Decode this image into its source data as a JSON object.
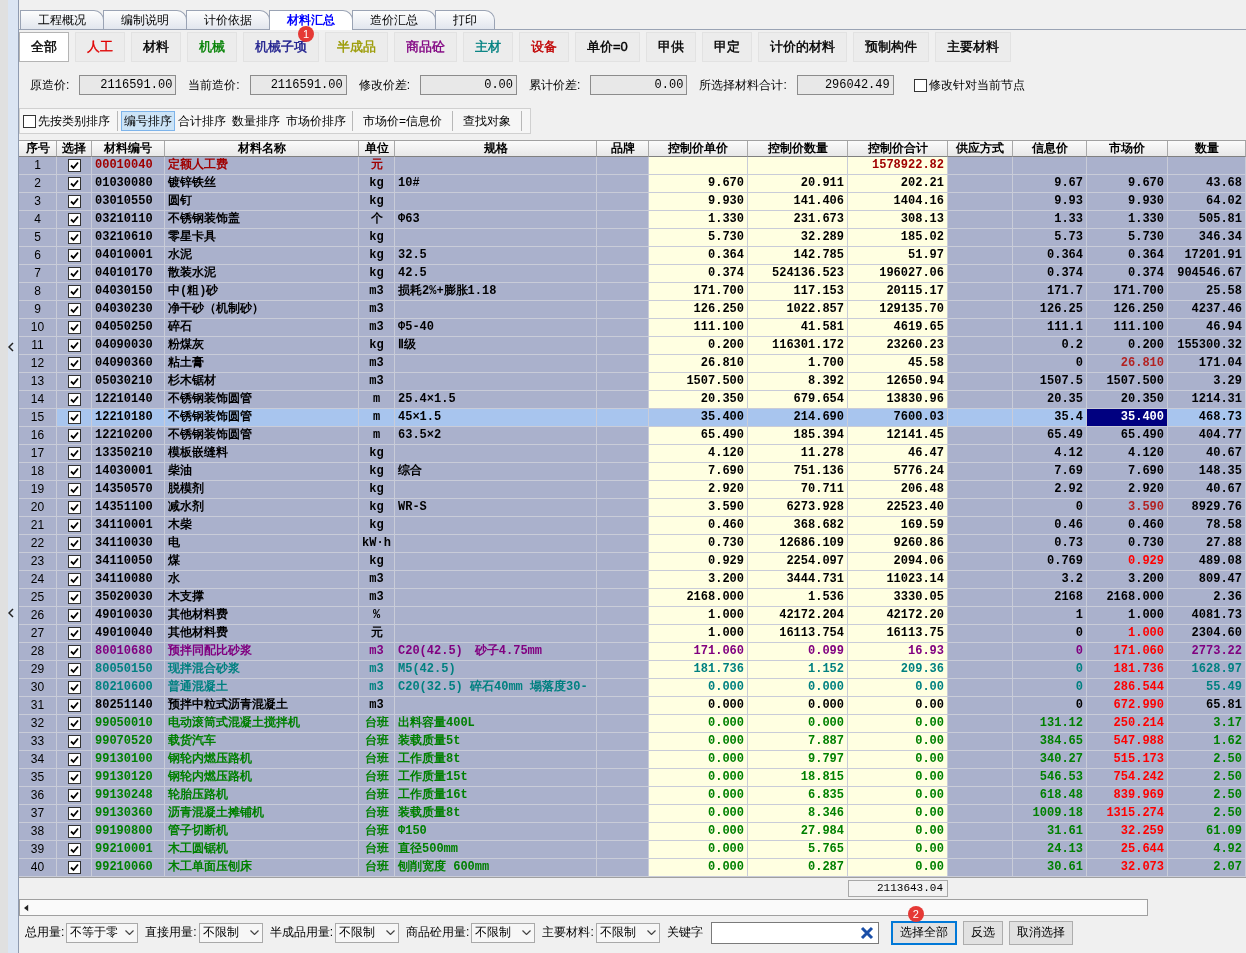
{
  "tabs": [
    {
      "label": "工程概况",
      "selected": false
    },
    {
      "label": "编制说明",
      "selected": false
    },
    {
      "label": "计价依据",
      "selected": false
    },
    {
      "label": "材料汇总",
      "selected": true
    },
    {
      "label": "造价汇总",
      "selected": false
    },
    {
      "label": "打印",
      "selected": false
    }
  ],
  "filters": [
    {
      "label": "全部",
      "color": "#000000",
      "selected": true
    },
    {
      "label": "人工",
      "color": "#e00000",
      "selected": false
    },
    {
      "label": "材料",
      "color": "#000000",
      "selected": false
    },
    {
      "label": "机械",
      "color": "#008000",
      "selected": false
    },
    {
      "label": "机械子项",
      "color": "#1c1c8c",
      "selected": false,
      "badge": "1"
    },
    {
      "label": "半成品",
      "color": "#9a9a00",
      "selected": false
    },
    {
      "label": "商品砼",
      "color": "#800080",
      "selected": false
    },
    {
      "label": "主材",
      "color": "#008080",
      "selected": false
    },
    {
      "label": "设备",
      "color": "#c00000",
      "selected": false
    },
    {
      "label": "单价=0",
      "color": "#000000",
      "selected": false
    },
    {
      "label": "甲供",
      "color": "#000000",
      "selected": false
    },
    {
      "label": "甲定",
      "color": "#000000",
      "selected": false
    },
    {
      "label": "计价的材料",
      "color": "#000000",
      "selected": false
    },
    {
      "label": "预制构件",
      "color": "#000000",
      "selected": false
    },
    {
      "label": "主要材料",
      "color": "#000000",
      "selected": false
    }
  ],
  "totals": [
    {
      "label": "原造价:",
      "value": "2116591.00"
    },
    {
      "label": "当前造价:",
      "value": "2116591.00"
    },
    {
      "label": "修改价差:",
      "value": "0.00"
    },
    {
      "label": "累计价差:",
      "value": "0.00"
    },
    {
      "label": "所选择材料合计:",
      "value": "296042.49"
    }
  ],
  "node_option": {
    "label": "修改针对当前节点",
    "checked": false
  },
  "sort_bar": {
    "category_first": {
      "label": "先按类别排序",
      "checked": false
    },
    "sorts": [
      {
        "label": "编号排序",
        "selected": true
      },
      {
        "label": "合计排序",
        "selected": false
      },
      {
        "label": "数量排序",
        "selected": false
      },
      {
        "label": "市场价排序",
        "selected": false
      }
    ],
    "actions": [
      "市场价=信息价",
      "查找对象"
    ]
  },
  "table": {
    "columns": [
      "序号",
      "选择",
      "材料编号",
      "材料名称",
      "单位",
      "规格",
      "品牌",
      "控制价单价",
      "控制价数量",
      "控制价合计",
      "供应方式",
      "信息价",
      "市场价",
      "数量"
    ],
    "rows": [
      {
        "no": "1",
        "checked": true,
        "selected": false,
        "color": "#a00000",
        "code": "00010040",
        "name": "定额人工费",
        "unit": "元",
        "ctrl_total": "1578922.82"
      },
      {
        "no": "2",
        "checked": true,
        "selected": false,
        "color": "#000000",
        "code": "01030080",
        "name": "镀锌铁丝",
        "unit": "kg",
        "spec": "10#",
        "ctrl_price": "9.670",
        "ctrl_qty": "20.911",
        "ctrl_total": "202.21",
        "info_price": "9.67",
        "market_price": {
          "text": "9.670",
          "color": "#000000"
        },
        "qty": "43.68"
      },
      {
        "no": "3",
        "checked": true,
        "selected": false,
        "color": "#000000",
        "code": "03010550",
        "name": "圆钉",
        "unit": "kg",
        "ctrl_price": "9.930",
        "ctrl_qty": "141.406",
        "ctrl_total": "1404.16",
        "info_price": "9.93",
        "market_price": {
          "text": "9.930",
          "color": "#000000"
        },
        "qty": "64.02"
      },
      {
        "no": "4",
        "checked": true,
        "selected": false,
        "color": "#000000",
        "code": "03210110",
        "name": "不锈钢装饰盖",
        "unit": "个",
        "spec": "Φ63",
        "ctrl_price": "1.330",
        "ctrl_qty": "231.673",
        "ctrl_total": "308.13",
        "info_price": "1.33",
        "market_price": {
          "text": "1.330",
          "color": "#000000"
        },
        "qty": "505.81"
      },
      {
        "no": "5",
        "checked": true,
        "selected": false,
        "color": "#000000",
        "code": "03210610",
        "name": "零星卡具",
        "unit": "kg",
        "ctrl_price": "5.730",
        "ctrl_qty": "32.289",
        "ctrl_total": "185.02",
        "info_price": "5.73",
        "market_price": {
          "text": "5.730",
          "color": "#000000"
        },
        "qty": "346.34"
      },
      {
        "no": "6",
        "checked": true,
        "selected": false,
        "color": "#000000",
        "code": "04010001",
        "name": "水泥",
        "unit": "kg",
        "spec": "32.5",
        "ctrl_price": "0.364",
        "ctrl_qty": "142.785",
        "ctrl_total": "51.97",
        "info_price": "0.364",
        "market_price": {
          "text": "0.364",
          "color": "#000000"
        },
        "qty": "17201.91"
      },
      {
        "no": "7",
        "checked": true,
        "selected": false,
        "color": "#000000",
        "code": "04010170",
        "name": "散装水泥",
        "unit": "kg",
        "spec": "42.5",
        "ctrl_price": "0.374",
        "ctrl_qty": "524136.523",
        "ctrl_total": "196027.06",
        "info_price": "0.374",
        "market_price": {
          "text": "0.374",
          "color": "#000000"
        },
        "qty": "904546.67"
      },
      {
        "no": "8",
        "checked": true,
        "selected": false,
        "color": "#000000",
        "code": "04030150",
        "name": "中(粗)砂",
        "unit": "m3",
        "spec": "损耗2%+膨胀1.18",
        "ctrl_price": "171.700",
        "ctrl_qty": "117.153",
        "ctrl_total": "20115.17",
        "info_price": "171.7",
        "market_price": {
          "text": "171.700",
          "color": "#000000"
        },
        "qty": "25.58"
      },
      {
        "no": "9",
        "checked": true,
        "selected": false,
        "color": "#000000",
        "code": "04030230",
        "name": "净干砂（机制砂）",
        "unit": "m3",
        "ctrl_price": "126.250",
        "ctrl_qty": "1022.857",
        "ctrl_total": "129135.70",
        "info_price": "126.25",
        "market_price": {
          "text": "126.250",
          "color": "#000000"
        },
        "qty": "4237.46"
      },
      {
        "no": "10",
        "checked": true,
        "selected": false,
        "color": "#000000",
        "code": "04050250",
        "name": "碎石",
        "unit": "m3",
        "spec": "Φ5-40",
        "ctrl_price": "111.100",
        "ctrl_qty": "41.581",
        "ctrl_total": "4619.65",
        "info_price": "111.1",
        "market_price": {
          "text": "111.100",
          "color": "#000000"
        },
        "qty": "46.94"
      },
      {
        "no": "11",
        "checked": true,
        "selected": false,
        "color": "#000000",
        "code": "04090030",
        "name": "粉煤灰",
        "unit": "kg",
        "spec": "Ⅱ级",
        "ctrl_price": "0.200",
        "ctrl_qty": "116301.172",
        "ctrl_total": "23260.23",
        "info_price": "0.2",
        "market_price": {
          "text": "0.200",
          "color": "#000000"
        },
        "qty": "155300.32"
      },
      {
        "no": "12",
        "checked": true,
        "selected": false,
        "color": "#000000",
        "code": "04090360",
        "name": "粘土膏",
        "unit": "m3",
        "ctrl_price": "26.810",
        "ctrl_qty": "1.700",
        "ctrl_total": "45.58",
        "info_price": "0",
        "market_price": {
          "text": "26.810",
          "color": "#b22222"
        },
        "qty": "171.04"
      },
      {
        "no": "13",
        "checked": true,
        "selected": false,
        "color": "#000000",
        "code": "05030210",
        "name": "杉木锯材",
        "unit": "m3",
        "ctrl_price": "1507.500",
        "ctrl_qty": "8.392",
        "ctrl_total": "12650.94",
        "info_price": "1507.5",
        "market_price": {
          "text": "1507.500",
          "color": "#000000"
        },
        "qty": "3.29"
      },
      {
        "no": "14",
        "checked": true,
        "selected": false,
        "color": "#000000",
        "code": "12210140",
        "name": "不锈钢装饰圆管",
        "unit": "m",
        "spec": "25.4×1.5",
        "ctrl_price": "20.350",
        "ctrl_qty": "679.654",
        "ctrl_total": "13830.96",
        "info_price": "20.35",
        "market_price": {
          "text": "20.350",
          "color": "#000000"
        },
        "qty": "1214.31"
      },
      {
        "no": "15",
        "checked": true,
        "selected": true,
        "code": "12210180",
        "name": "不锈钢装饰圆管",
        "unit": "m",
        "spec": "45×1.5",
        "ctrl_price": "35.400",
        "ctrl_qty": "214.690",
        "ctrl_total": "7600.03",
        "info_price": "35.4",
        "market_price": {
          "text": "35.400"
        },
        "qty": "468.73"
      },
      {
        "no": "16",
        "checked": true,
        "selected": false,
        "color": "#000000",
        "code": "12210200",
        "name": "不锈钢装饰圆管",
        "unit": "m",
        "spec": "63.5×2",
        "ctrl_price": "65.490",
        "ctrl_qty": "185.394",
        "ctrl_total": "12141.45",
        "info_price": "65.49",
        "market_price": {
          "text": "65.490",
          "color": "#000000"
        },
        "qty": "404.77"
      },
      {
        "no": "17",
        "checked": true,
        "selected": false,
        "color": "#000000",
        "code": "13350210",
        "name": "模板嵌缝料",
        "unit": "kg",
        "ctrl_price": "4.120",
        "ctrl_qty": "11.278",
        "ctrl_total": "46.47",
        "info_price": "4.12",
        "market_price": {
          "text": "4.120",
          "color": "#000000"
        },
        "qty": "40.67"
      },
      {
        "no": "18",
        "checked": true,
        "selected": false,
        "color": "#000000",
        "code": "14030001",
        "name": "柴油",
        "unit": "kg",
        "spec": "综合",
        "ctrl_price": "7.690",
        "ctrl_qty": "751.136",
        "ctrl_total": "5776.24",
        "info_price": "7.69",
        "market_price": {
          "text": "7.690",
          "color": "#000000"
        },
        "qty": "148.35"
      },
      {
        "no": "19",
        "checked": true,
        "selected": false,
        "color": "#000000",
        "code": "14350570",
        "name": "脱模剂",
        "unit": "kg",
        "ctrl_price": "2.920",
        "ctrl_qty": "70.711",
        "ctrl_total": "206.48",
        "info_price": "2.92",
        "market_price": {
          "text": "2.920",
          "color": "#000000"
        },
        "qty": "40.67"
      },
      {
        "no": "20",
        "checked": true,
        "selected": false,
        "color": "#000000",
        "code": "14351100",
        "name": "减水剂",
        "unit": "kg",
        "spec": "WR-S",
        "ctrl_price": "3.590",
        "ctrl_qty": "6273.928",
        "ctrl_total": "22523.40",
        "info_price": "0",
        "market_price": {
          "text": "3.590",
          "color": "#b22222"
        },
        "qty": "8929.76"
      },
      {
        "no": "21",
        "checked": true,
        "selected": false,
        "color": "#000000",
        "code": "34110001",
        "name": "木柴",
        "unit": "kg",
        "ctrl_price": "0.460",
        "ctrl_qty": "368.682",
        "ctrl_total": "169.59",
        "info_price": "0.46",
        "market_price": {
          "text": "0.460",
          "color": "#000000"
        },
        "qty": "78.58"
      },
      {
        "no": "22",
        "checked": true,
        "selected": false,
        "color": "#000000",
        "code": "34110030",
        "name": "电",
        "unit": "kW·h",
        "ctrl_price": "0.730",
        "ctrl_qty": "12686.109",
        "ctrl_total": "9260.86",
        "info_price": "0.73",
        "market_price": {
          "text": "0.730",
          "color": "#000000"
        },
        "qty": "27.88"
      },
      {
        "no": "23",
        "checked": true,
        "selected": false,
        "color": "#000000",
        "code": "34110050",
        "name": "煤",
        "unit": "kg",
        "ctrl_price": "0.929",
        "ctrl_qty": "2254.097",
        "ctrl_total": "2094.06",
        "info_price": "0.769",
        "market_price": {
          "text": "0.929",
          "color": "#ff0000"
        },
        "qty": "489.08"
      },
      {
        "no": "24",
        "checked": true,
        "selected": false,
        "color": "#000000",
        "code": "34110080",
        "name": "水",
        "unit": "m3",
        "ctrl_price": "3.200",
        "ctrl_qty": "3444.731",
        "ctrl_total": "11023.14",
        "info_price": "3.2",
        "market_price": {
          "text": "3.200",
          "color": "#000000"
        },
        "qty": "809.47"
      },
      {
        "no": "25",
        "checked": true,
        "selected": false,
        "color": "#000000",
        "code": "35020030",
        "name": "木支撑",
        "unit": "m3",
        "ctrl_price": "2168.000",
        "ctrl_qty": "1.536",
        "ctrl_total": "3330.05",
        "info_price": "2168",
        "market_price": {
          "text": "2168.000",
          "color": "#000000"
        },
        "qty": "2.36"
      },
      {
        "no": "26",
        "checked": true,
        "selected": false,
        "color": "#000000",
        "code": "49010030",
        "name": "其他材料费",
        "unit": "%",
        "ctrl_price": "1.000",
        "ctrl_qty": "42172.204",
        "ctrl_total": "42172.20",
        "info_price": "1",
        "market_price": {
          "text": "1.000",
          "color": "#000000"
        },
        "qty": "4081.73"
      },
      {
        "no": "27",
        "checked": true,
        "selected": false,
        "color": "#000000",
        "code": "49010040",
        "name": "其他材料费",
        "unit": "元",
        "ctrl_price": "1.000",
        "ctrl_qty": "16113.754",
        "ctrl_total": "16113.75",
        "info_price": "0",
        "market_price": {
          "text": "1.000",
          "color": "#ff0000"
        },
        "qty": "2304.60"
      },
      {
        "no": "28",
        "checked": true,
        "selected": false,
        "color": "#800080",
        "code": "80010680",
        "name": "预拌同配比砂浆",
        "unit": "m3",
        "spec": "C20(42.5)　砂子4.75mm",
        "ctrl_price": "171.060",
        "ctrl_qty": "0.099",
        "ctrl_total": "16.93",
        "info_price": "0",
        "market_price": {
          "text": "171.060",
          "color": "#ff0000"
        },
        "qty": "2773.22"
      },
      {
        "no": "29",
        "checked": true,
        "selected": false,
        "color": "#008080",
        "code": "80050150",
        "name": "现拌混合砂浆",
        "unit": "m3",
        "spec": "M5(42.5)",
        "ctrl_price": "181.736",
        "ctrl_qty": "1.152",
        "ctrl_total": "209.36",
        "info_price": "0",
        "market_price": {
          "text": "181.736",
          "color": "#ff0000"
        },
        "qty": "1628.97"
      },
      {
        "no": "30",
        "checked": true,
        "selected": false,
        "color": "#008080",
        "code": "80210600",
        "name": "普通混凝土",
        "unit": "m3",
        "spec": "C20(32.5) 碎石40mm 塌落度30-",
        "ctrl_price": "0.000",
        "ctrl_qty": "0.000",
        "ctrl_total": "0.00",
        "info_price": "0",
        "market_price": {
          "text": "286.544",
          "color": "#ff0000"
        },
        "qty": "55.49"
      },
      {
        "no": "31",
        "checked": true,
        "selected": false,
        "color": "#000000",
        "code": "80251140",
        "name": "预拌中粒式沥青混凝土",
        "unit": "m3",
        "ctrl_price": "0.000",
        "ctrl_qty": "0.000",
        "ctrl_total": "0.00",
        "info_price": "0",
        "market_price": {
          "text": "672.990",
          "color": "#ff0000"
        },
        "qty": "65.81"
      },
      {
        "no": "32",
        "checked": true,
        "selected": false,
        "color": "#008000",
        "code": "99050010",
        "name": "电动滚筒式混凝土搅拌机",
        "unit": "台班",
        "spec": "出料容量400L",
        "ctrl_price": "0.000",
        "ctrl_qty": "0.000",
        "ctrl_total": "0.00",
        "info_price": "131.12",
        "market_price": {
          "text": "250.214",
          "color": "#ff0000"
        },
        "qty": "3.17"
      },
      {
        "no": "33",
        "checked": true,
        "selected": false,
        "color": "#008000",
        "code": "99070520",
        "name": "载货汽车",
        "unit": "台班",
        "spec": "装载质量5t",
        "ctrl_price": "0.000",
        "ctrl_qty": "7.887",
        "ctrl_total": "0.00",
        "info_price": "384.65",
        "market_price": {
          "text": "547.988",
          "color": "#ff0000"
        },
        "qty": "1.62"
      },
      {
        "no": "34",
        "checked": true,
        "selected": false,
        "color": "#008000",
        "code": "99130100",
        "name": "钢轮内燃压路机",
        "unit": "台班",
        "spec": "工作质量8t",
        "ctrl_price": "0.000",
        "ctrl_qty": "9.797",
        "ctrl_total": "0.00",
        "info_price": "340.27",
        "market_price": {
          "text": "515.173",
          "color": "#ff0000"
        },
        "qty": "2.50"
      },
      {
        "no": "35",
        "checked": true,
        "selected": false,
        "color": "#008000",
        "code": "99130120",
        "name": "钢轮内燃压路机",
        "unit": "台班",
        "spec": "工作质量15t",
        "ctrl_price": "0.000",
        "ctrl_qty": "18.815",
        "ctrl_total": "0.00",
        "info_price": "546.53",
        "market_price": {
          "text": "754.242",
          "color": "#ff0000"
        },
        "qty": "2.50"
      },
      {
        "no": "36",
        "checked": true,
        "selected": false,
        "color": "#008000",
        "code": "99130248",
        "name": "轮胎压路机",
        "unit": "台班",
        "spec": "工作质量16t",
        "ctrl_price": "0.000",
        "ctrl_qty": "6.835",
        "ctrl_total": "0.00",
        "info_price": "618.48",
        "market_price": {
          "text": "839.969",
          "color": "#ff0000"
        },
        "qty": "2.50"
      },
      {
        "no": "37",
        "checked": true,
        "selected": false,
        "color": "#008000",
        "code": "99130360",
        "name": "沥青混凝土摊铺机",
        "unit": "台班",
        "spec": "装载质量8t",
        "ctrl_price": "0.000",
        "ctrl_qty": "8.346",
        "ctrl_total": "0.00",
        "info_price": "1009.18",
        "market_price": {
          "text": "1315.274",
          "color": "#ff0000"
        },
        "qty": "2.50"
      },
      {
        "no": "38",
        "checked": true,
        "selected": false,
        "color": "#008000",
        "code": "99190800",
        "name": "管子切断机",
        "unit": "台班",
        "spec": "Φ150",
        "ctrl_price": "0.000",
        "ctrl_qty": "27.984",
        "ctrl_total": "0.00",
        "info_price": "31.61",
        "market_price": {
          "text": "32.259",
          "color": "#ff0000"
        },
        "qty": "61.09"
      },
      {
        "no": "39",
        "checked": true,
        "selected": false,
        "color": "#008000",
        "code": "99210001",
        "name": "木工圆锯机",
        "unit": "台班",
        "spec": "直径500mm",
        "ctrl_price": "0.000",
        "ctrl_qty": "5.765",
        "ctrl_total": "0.00",
        "info_price": "24.13",
        "market_price": {
          "text": "25.644",
          "color": "#ff0000"
        },
        "qty": "4.92"
      },
      {
        "no": "40",
        "checked": true,
        "selected": false,
        "color": "#008000",
        "code": "99210060",
        "name": "木工单面压刨床",
        "unit": "台班",
        "spec": "刨削宽度 600mm",
        "ctrl_price": "0.000",
        "ctrl_qty": "0.287",
        "ctrl_total": "0.00",
        "info_price": "30.61",
        "market_price": {
          "text": "32.073",
          "color": "#ff0000"
        },
        "qty": "2.07"
      }
    ],
    "footer_total": "2113643.04"
  },
  "bottom_bar": {
    "filters": [
      {
        "label": "总用量:",
        "value": "不等于零"
      },
      {
        "label": "直接用量:",
        "value": "不限制"
      },
      {
        "label": "半成品用量:",
        "value": "不限制"
      },
      {
        "label": "商品砼用量:",
        "value": "不限制"
      },
      {
        "label": "主要材料:",
        "value": "不限制"
      }
    ],
    "keyword": {
      "label": "关键字"
    },
    "buttons": [
      {
        "label": "选择全部",
        "focused": true,
        "badge": "2"
      },
      {
        "label": "反选",
        "focused": false
      },
      {
        "label": "取消选择",
        "focused": false
      }
    ]
  }
}
